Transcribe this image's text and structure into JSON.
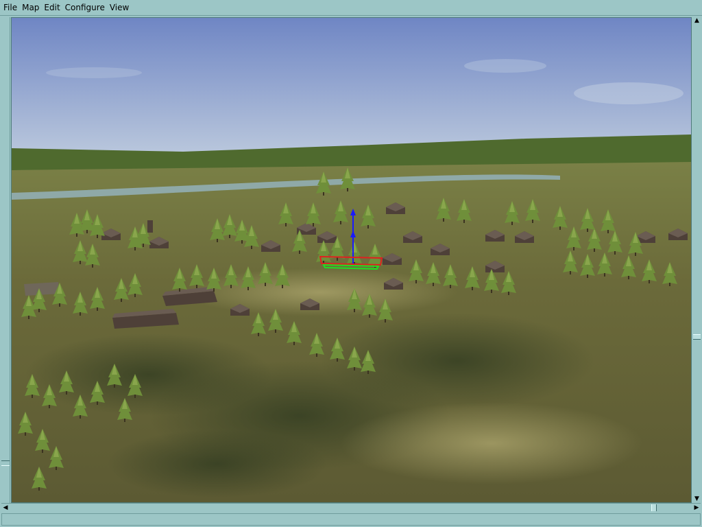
{
  "menubar": {
    "items": [
      "File",
      "Map",
      "Edit",
      "Configure",
      "View"
    ]
  },
  "viewport": {
    "scene": "3d-terrain-view",
    "colors": {
      "sky_top": "#6f86c4",
      "sky_horizon": "#b8c6dc",
      "hills": "#4f6a2e",
      "river": "#8fa9a8",
      "ground": "#6b6a3a",
      "tree": "#6f8f3a",
      "building": "#4e4038",
      "gizmo_up": "#1a1aff",
      "gizmo_x": "#e02020",
      "gizmo_y": "#20e020"
    }
  },
  "scrollbars": {
    "left_arrow": "◀",
    "right_arrow": "▶",
    "up_arrow": "▲",
    "down_arrow": "▼"
  },
  "statusbar": {
    "text": ""
  }
}
